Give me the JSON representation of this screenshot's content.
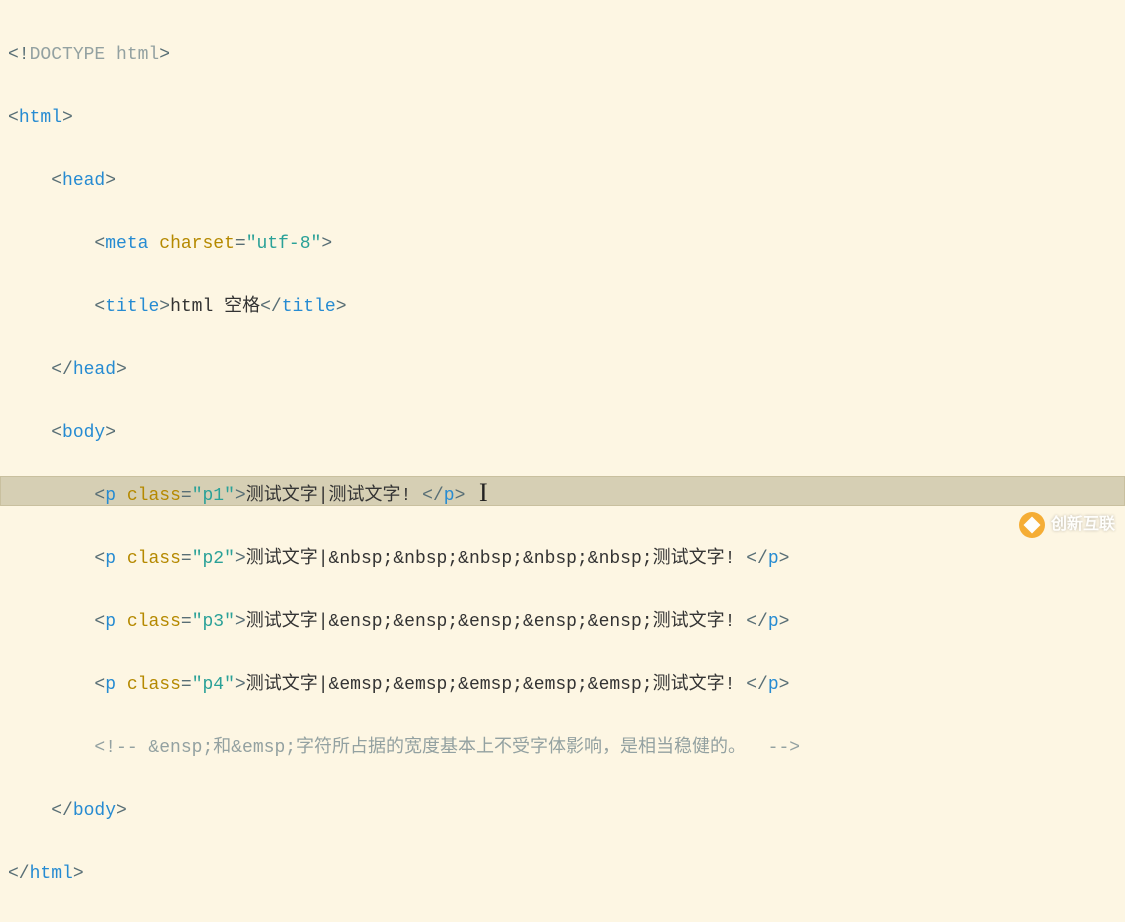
{
  "code": {
    "doctype": "<!DOCTYPE html>",
    "htmlOpen": "html",
    "htmlClose": "html",
    "headOpen": "head",
    "headClose": "head",
    "metaTag": "meta",
    "metaAttr": "charset",
    "metaVal": "utf-8",
    "titleTag": "title",
    "titleText": "html 空格",
    "bodyOpen": "body",
    "bodyClose": "body",
    "pTag": "p",
    "classAttr": "class",
    "p1Val": "p1",
    "p1Text": "测试文字|测试文字! ",
    "p2Val": "p2",
    "p2Text": "测试文字|&nbsp;&nbsp;&nbsp;&nbsp;&nbsp;测试文字! ",
    "p3Val": "p3",
    "p3Text": "测试文字|&ensp;&ensp;&ensp;&ensp;&ensp;测试文字! ",
    "p4Val": "p4",
    "p4Text": "测试文字|&emsp;&emsp;&emsp;&emsp;&emsp;测试文字! ",
    "comment": "<!-- &ensp;和&emsp;字符所占据的宽度基本上不受字体影响，是相当稳健的。  -->"
  },
  "watermark": "创新互联"
}
